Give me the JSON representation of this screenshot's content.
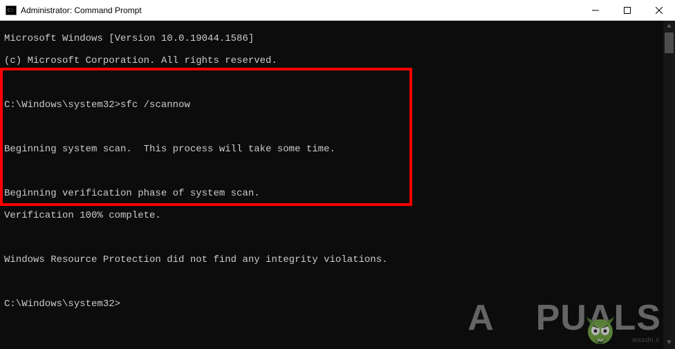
{
  "titlebar": {
    "title": "Administrator: Command Prompt"
  },
  "console": {
    "line1": "Microsoft Windows [Version 10.0.19044.1586]",
    "line2": "(c) Microsoft Corporation. All rights reserved.",
    "blank1": "",
    "prompt1_path": "C:\\Windows\\system32>",
    "prompt1_cmd": "sfc /scannow",
    "blank2": "",
    "scan_begin": "Beginning system scan.  This process will take some time.",
    "blank3": "",
    "verify_begin": "Beginning verification phase of system scan.",
    "verify_complete": "Verification 100% complete.",
    "blank4": "",
    "result": "Windows Resource Protection did not find any integrity violations.",
    "blank5": "",
    "prompt2": "C:\\Windows\\system32>"
  },
  "watermark": {
    "prefix": "A",
    "suffix": "PUALS",
    "sub": "wssdn.c"
  }
}
